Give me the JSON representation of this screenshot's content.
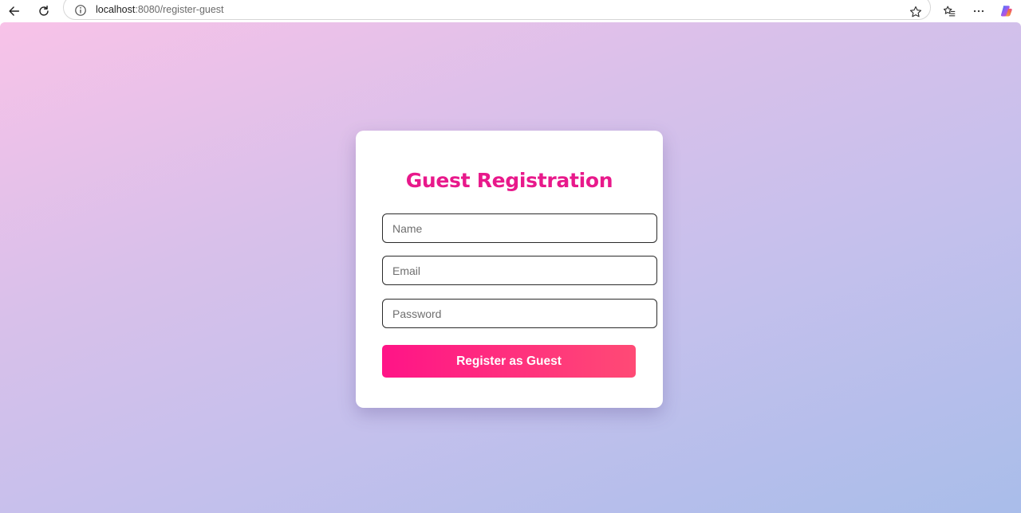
{
  "browser": {
    "url_host": "localhost",
    "url_rest": ":8080/register-guest",
    "back_icon": "arrow-left-icon",
    "reload_icon": "reload-icon",
    "info_icon": "info-icon",
    "star_icon": "star-icon",
    "favorites_icon": "favorites-icon",
    "more_icon": "more-horizontal-icon",
    "copilot_icon": "copilot-icon"
  },
  "form": {
    "title": "Guest Registration",
    "name_placeholder": "Name",
    "email_placeholder": "Email",
    "password_placeholder": "Password",
    "submit_label": "Register as Guest"
  },
  "colors": {
    "title": "#e8198b",
    "button_start": "#ff1487",
    "button_end": "#ff4a75",
    "background_start": "#f8c2e8",
    "background_end": "#a9bdea"
  }
}
